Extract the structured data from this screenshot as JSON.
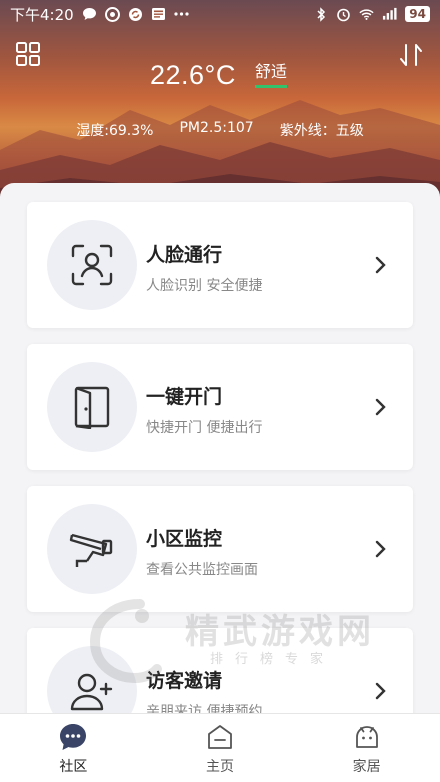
{
  "status_bar": {
    "time": "下午4:20",
    "battery": "94"
  },
  "weather": {
    "temperature": "22.6°C",
    "comfort": "舒适",
    "humidity": "湿度:69.3%",
    "pm25": "PM2.5:107",
    "uv": "紫外线：五级"
  },
  "cards": [
    {
      "title": "人脸通行",
      "subtitle": "人脸识别 安全便捷",
      "icon": "face-scan-icon"
    },
    {
      "title": "一键开门",
      "subtitle": "快捷开门 便捷出行",
      "icon": "door-icon"
    },
    {
      "title": "小区监控",
      "subtitle": "查看公共监控画面",
      "icon": "cctv-camera-icon"
    },
    {
      "title": "访客邀请",
      "subtitle": "亲朋来访 便捷预约",
      "icon": "add-visitor-icon"
    }
  ],
  "watermark": {
    "text": "精武游戏网",
    "sub": "排行榜专家"
  },
  "tabs": [
    {
      "label": "社区",
      "icon": "chat-bubble-icon",
      "active": true
    },
    {
      "label": "主页",
      "icon": "home-icon",
      "active": false
    },
    {
      "label": "家居",
      "icon": "android-robot-icon",
      "active": false
    }
  ],
  "colors": {
    "comfort_underline": "#32c26b",
    "tab_active_icon": "#3a4466",
    "card_icon_bg": "#eeeff4"
  }
}
